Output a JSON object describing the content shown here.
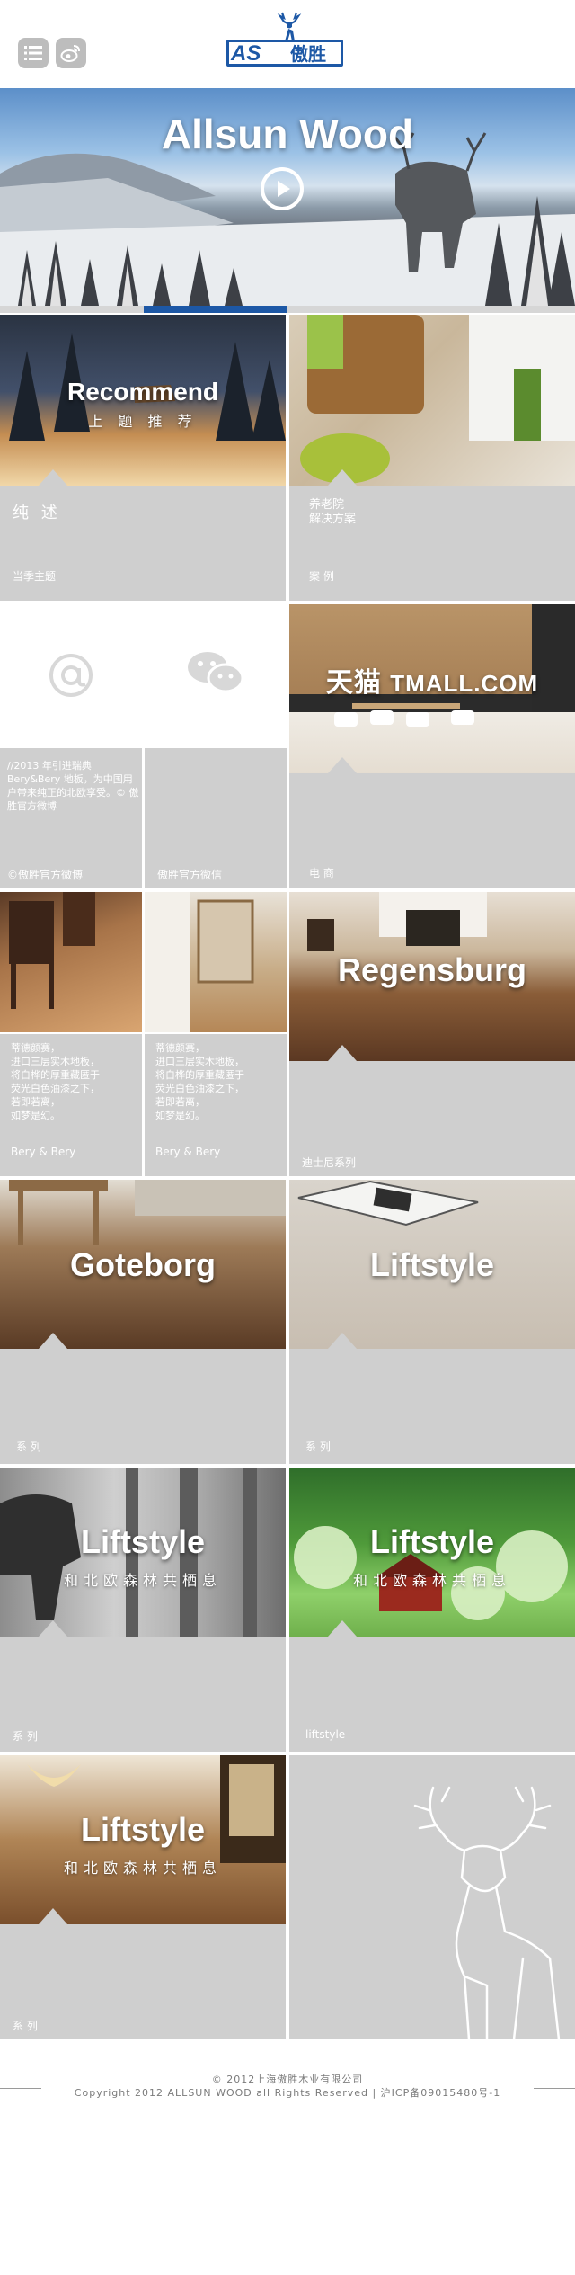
{
  "header": {
    "menu_icon": "list-icon",
    "weibo_icon": "weibo-icon",
    "logo_as": "AS",
    "logo_cn": "傲胜"
  },
  "hero": {
    "title": "Allsun Wood",
    "play_icon": "play-icon",
    "slide_progress": "slide 2 of 4"
  },
  "tiles": {
    "recommend": {
      "title": "Recommend",
      "subtitle": "上 题 推 荐",
      "heading": "纯 述",
      "caption": "当季主题"
    },
    "nursing": {
      "heading_line1": "养老院",
      "heading_line2": "解决方案",
      "caption": "案 例"
    },
    "email": {
      "icon": "at-icon"
    },
    "wechat": {
      "icon": "wechat-icon"
    },
    "weibo_text": {
      "text": "//2013 年引进瑞典 Bery&Bery 地板，为中国用户带来纯正的北欧享受。© 傲胜官方微博",
      "caption": "©傲胜官方微博"
    },
    "wechat_text": {
      "caption": "傲胜官方微信"
    },
    "tmall": {
      "logo_cn": "天猫",
      "logo_en": "TMALL.COM",
      "caption": "电 商"
    },
    "bery1": {
      "text": "蒂德颜赛，\n进口三层实木地板，\n将白桦的厚重藏匿于\n荧光白色油漆之下，\n若即若离，\n如梦是幻。",
      "caption": "Bery & Bery"
    },
    "bery2": {
      "text": "蒂德颜赛，\n进口三层实木地板，\n将白桦的厚重藏匿于\n荧光白色油漆之下，\n若即若离，\n如梦是幻。",
      "caption": "Bery & Bery"
    },
    "regensburg": {
      "title": "Regensburg",
      "caption": "迪士尼系列"
    },
    "goteborg": {
      "title": "Goteborg",
      "caption": "系 列"
    },
    "liftstyle1": {
      "title": "Liftstyle",
      "caption": "系 列"
    },
    "liftstyle2": {
      "title": "Liftstyle",
      "subtitle": "和北欧森林共栖息",
      "caption": "系 列"
    },
    "liftstyle3": {
      "title": "Liftstyle",
      "subtitle": "和北欧森林共栖息",
      "caption": "liftstyle"
    },
    "liftstyle4": {
      "title": "Liftstyle",
      "subtitle": "和北欧森林共栖息",
      "caption": "系 列"
    },
    "deer": {
      "icon": "deer-outline-icon"
    }
  },
  "footer": {
    "line1": "© 2012上海傲胜木业有限公司",
    "line2": "Copyright 2012 ALLSUN WOOD all Rights Reserved | 沪ICP备09015480号-1"
  },
  "colors": {
    "brand": "#1d58a6",
    "tile_gray": "#cfcfcf"
  }
}
